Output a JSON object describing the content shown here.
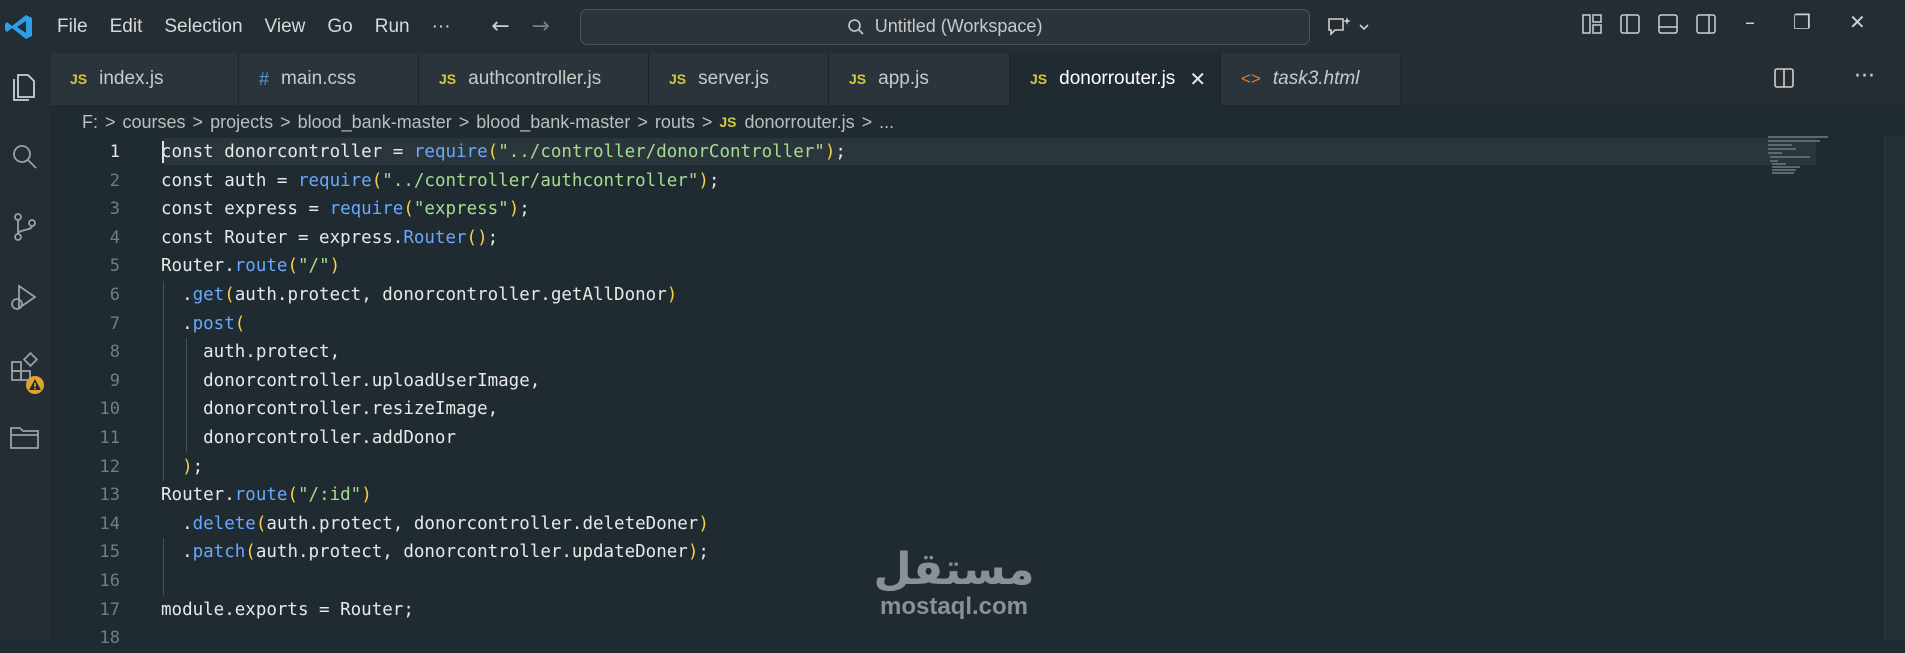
{
  "menu": [
    "File",
    "Edit",
    "Selection",
    "View",
    "Go",
    "Run",
    "···"
  ],
  "command_center": {
    "label": "Untitled (Workspace)"
  },
  "tabs": [
    {
      "label": "index.js",
      "icon": "JS"
    },
    {
      "label": "main.css",
      "icon": "#"
    },
    {
      "label": "authcontroller.js",
      "icon": "JS"
    },
    {
      "label": "server.js",
      "icon": "JS"
    },
    {
      "label": "app.js",
      "icon": "JS"
    },
    {
      "label": "donorrouter.js",
      "icon": "JS"
    },
    {
      "label": "task3.html",
      "icon": "<>"
    }
  ],
  "breadcrumb": {
    "parts": [
      "F:",
      "courses",
      "projects",
      "blood_bank-master",
      "blood_bank-master",
      "routs"
    ],
    "file_icon": "JS",
    "file": "donorrouter.js",
    "more": "..."
  },
  "editor": {
    "line_numbers": [
      "1",
      "2",
      "3",
      "4",
      "5",
      "6",
      "7",
      "8",
      "9",
      "10",
      "11",
      "12",
      "13",
      "14",
      "15",
      "16",
      "17",
      "18"
    ],
    "lines": [
      {
        "t1": "const donorcontroller = ",
        "fn": "require",
        "p": "(",
        "s": "\"../controller/donorController\"",
        "pe": ")",
        "end": ";"
      },
      {
        "t1": "const auth = ",
        "fn": "require",
        "p": "(",
        "s": "\"../controller/authcontroller\"",
        "pe": ")",
        "end": ";"
      },
      {
        "t1": "const express = ",
        "fn": "require",
        "p": "(",
        "s": "\"express\"",
        "pe": ")",
        "end": ";"
      },
      {
        "t1": "const Router = express.",
        "fn": "Router",
        "p": "(",
        "s": "",
        "pe": ")",
        "end": ";"
      },
      {
        "t1": "Router.",
        "fn": "route",
        "p": "(",
        "s": "\"/\"",
        "pe": ")",
        "end": ""
      },
      {
        "t1": "  .",
        "fn": "get",
        "p": "(",
        "s": "auth.protect, donorcontroller.getAllDonor",
        "pe": ")",
        "end": ""
      },
      {
        "t1": "  .",
        "fn": "post",
        "p": "(",
        "s": "",
        "pe": "",
        "end": ""
      },
      {
        "t1": "    auth.protect,",
        "fn": "",
        "p": "",
        "s": "",
        "pe": "",
        "end": ""
      },
      {
        "t1": "    donorcontroller.uploadUserImage,",
        "fn": "",
        "p": "",
        "s": "",
        "pe": "",
        "end": ""
      },
      {
        "t1": "    donorcontroller.resizeImage,",
        "fn": "",
        "p": "",
        "s": "",
        "pe": "",
        "end": ""
      },
      {
        "t1": "    donorcontroller.addDonor",
        "fn": "",
        "p": "",
        "s": "",
        "pe": "",
        "end": ""
      },
      {
        "t1": "  ",
        "fn": "",
        "p": ")",
        "s": "",
        "pe": "",
        "end": ";"
      },
      {
        "t1": "Router.",
        "fn": "route",
        "p": "(",
        "s": "\"/:id\"",
        "pe": ")",
        "end": ""
      },
      {
        "t1": "  .",
        "fn": "delete",
        "p": "(",
        "s": "auth.protect, donorcontroller.deleteDoner",
        "pe": ")",
        "end": ""
      },
      {
        "t1": "  .",
        "fn": "patch",
        "p": "(",
        "s": "auth.protect, donorcontroller.updateDoner",
        "pe": ")",
        "end": ";"
      },
      {
        "t1": "",
        "fn": "",
        "p": "",
        "s": "",
        "pe": "",
        "end": ""
      },
      {
        "t1": "module.exports = Router;",
        "fn": "",
        "p": "",
        "s": "",
        "pe": "",
        "end": ""
      },
      {
        "t1": "",
        "fn": "",
        "p": "",
        "s": "",
        "pe": "",
        "end": ""
      }
    ]
  },
  "watermark": {
    "arabic": "مستقل",
    "latin": "mostaql.com"
  },
  "colors": {
    "accent_js": "#d5c83f",
    "accent_css": "#5a93d6",
    "accent_html": "#e37933",
    "keyword_fn": "#6aa8ff",
    "string": "#a6dc8f"
  }
}
